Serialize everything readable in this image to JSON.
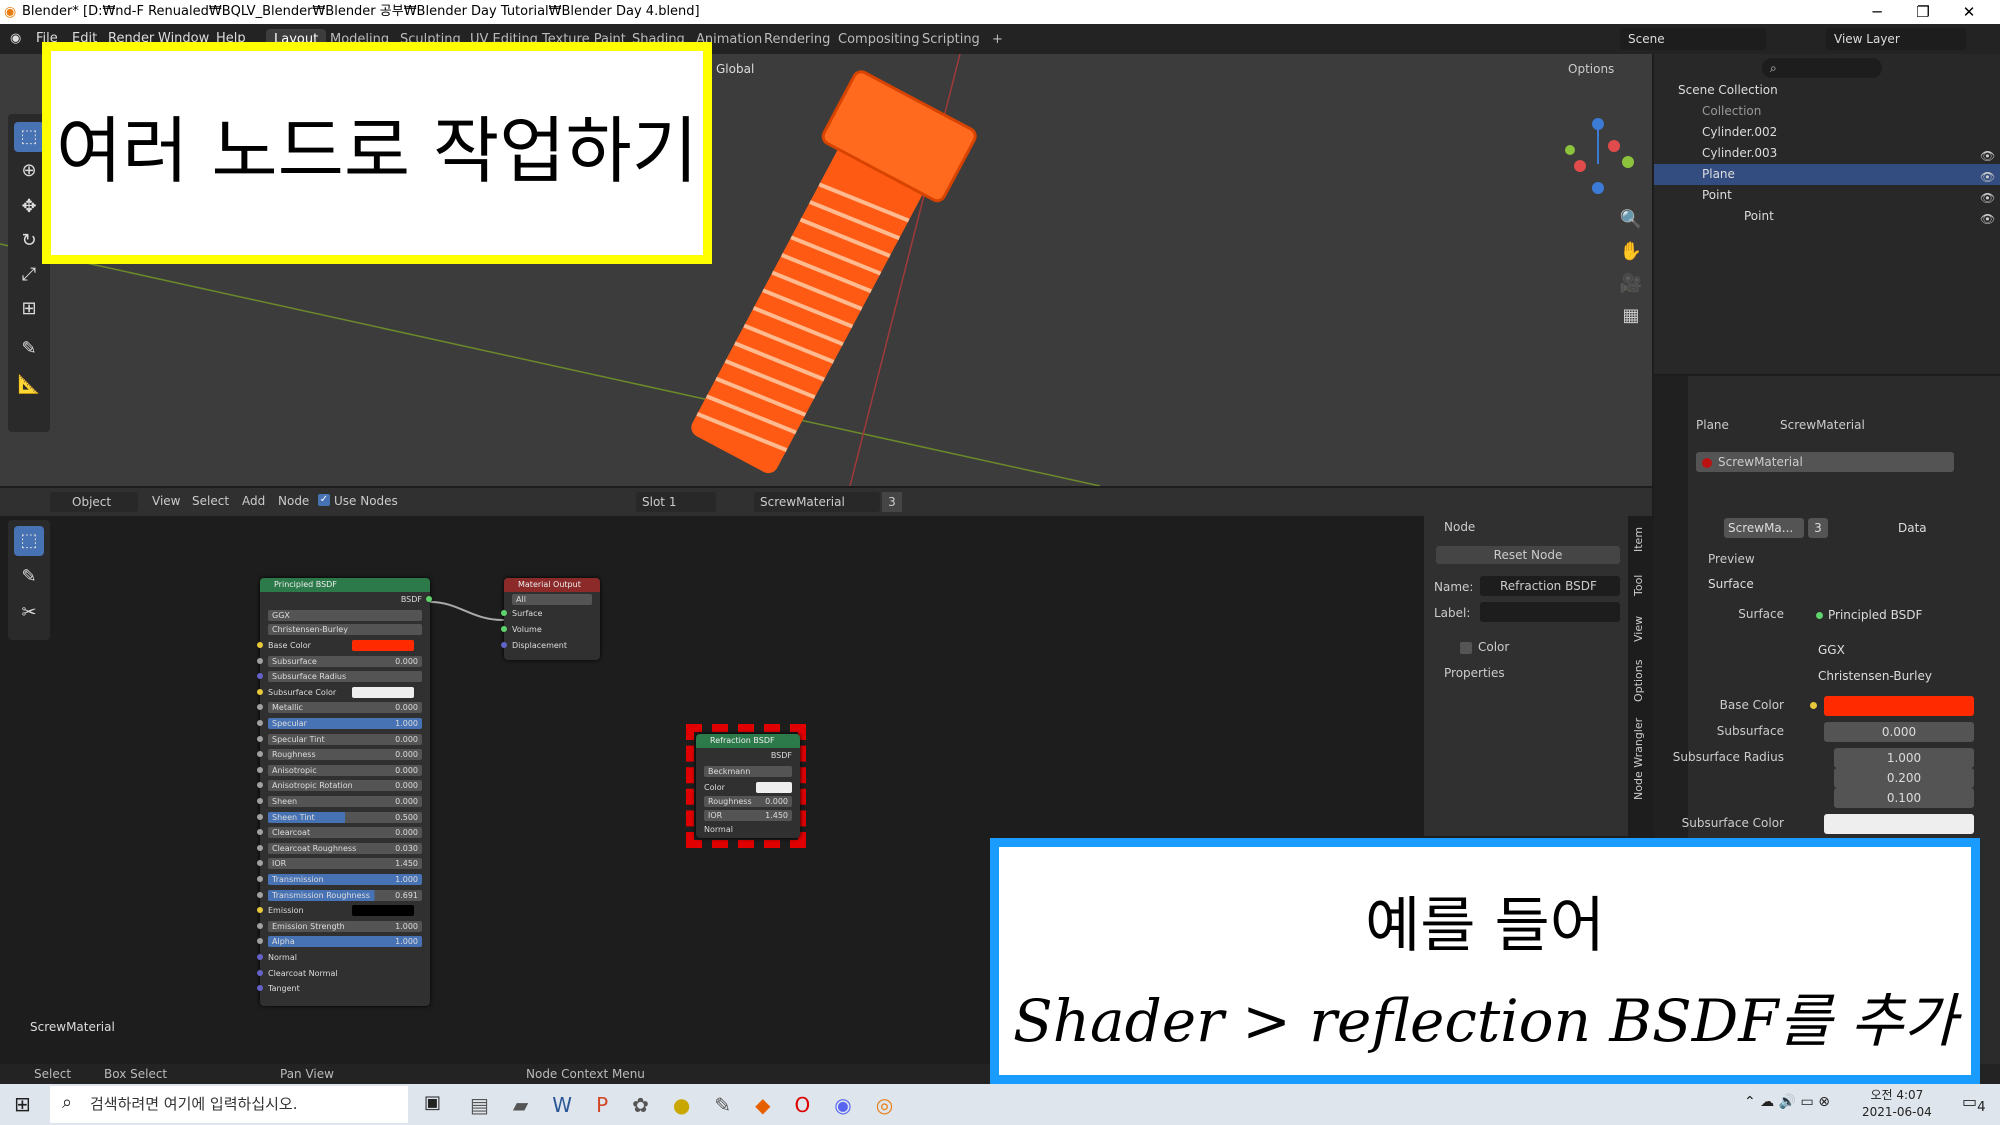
{
  "window": {
    "title": "Blender* [D:₩nd-F Renualed₩BQLV_Blender₩Blender 공부₩Blender Day Tutorial₩Blender Day 4.blend]"
  },
  "menu": {
    "file": "File",
    "edit": "Edit",
    "render": "Render",
    "window": "Window",
    "help": "Help"
  },
  "workspaces": [
    "Layout",
    "Modeling",
    "Sculpting",
    "UV Editing",
    "Texture Paint",
    "Shading",
    "Animation",
    "Rendering",
    "Compositing",
    "Scripting"
  ],
  "scene": {
    "name": "Scene",
    "view_layer": "View Layer"
  },
  "viewport": {
    "orientation": "Global",
    "options": "Options"
  },
  "outliner": {
    "root": "Scene Collection",
    "items": [
      {
        "label": "Collection"
      },
      {
        "label": "Cylinder.002"
      },
      {
        "label": "Cylinder.003"
      },
      {
        "label": "Plane"
      },
      {
        "label": "Point"
      },
      {
        "label": "Point"
      }
    ]
  },
  "properties": {
    "object": "Plane",
    "material": "ScrewMaterial",
    "slot_material": "ScrewMaterial",
    "mat_short": "ScrewMa...",
    "users": "3",
    "data": "Data",
    "preview": "Preview",
    "surface_section": "Surface",
    "surface_label": "Surface",
    "surface_value": "Principled BSDF",
    "distribution": "GGX",
    "subsurface_method": "Christensen-Burley",
    "base_color_label": "Base Color",
    "subsurface_label": "Subsurface",
    "subsurface_value": "0.000",
    "subsurface_radius_label": "Subsurface Radius",
    "radius": [
      "1.000",
      "0.200",
      "0.100"
    ],
    "subsurface_color_label": "Subsurface Color"
  },
  "node_header": {
    "mode": "Object",
    "view": "View",
    "select": "Select",
    "add": "Add",
    "node": "Node",
    "use_nodes": "Use Nodes",
    "slot": "Slot 1",
    "material": "ScrewMaterial",
    "users": "3"
  },
  "node_sidebar": {
    "section": "Node",
    "reset": "Reset Node",
    "name_label": "Name:",
    "name_value": "Refraction BSDF",
    "label_label": "Label:",
    "color": "Color",
    "properties": "Properties"
  },
  "sidebar_tabs": [
    "Item",
    "Tool",
    "View",
    "Options",
    "Node Wrangler"
  ],
  "principled": {
    "title": "Principled BSDF",
    "output": "BSDF",
    "dist": "GGX",
    "sss": "Christensen-Burley",
    "rows": [
      {
        "label": "Base Color",
        "value": ""
      },
      {
        "label": "Subsurface",
        "value": "0.000"
      },
      {
        "label": "Subsurface Radius",
        "value": ""
      },
      {
        "label": "Subsurface Color",
        "value": ""
      },
      {
        "label": "Metallic",
        "value": "0.000"
      },
      {
        "label": "Specular",
        "value": "1.000"
      },
      {
        "label": "Specular Tint",
        "value": "0.000"
      },
      {
        "label": "Roughness",
        "value": "0.000"
      },
      {
        "label": "Anisotropic",
        "value": "0.000"
      },
      {
        "label": "Anisotropic Rotation",
        "value": "0.000"
      },
      {
        "label": "Sheen",
        "value": "0.000"
      },
      {
        "label": "Sheen Tint",
        "value": "0.500"
      },
      {
        "label": "Clearcoat",
        "value": "0.000"
      },
      {
        "label": "Clearcoat Roughness",
        "value": "0.030"
      },
      {
        "label": "IOR",
        "value": "1.450"
      },
      {
        "label": "Transmission",
        "value": "1.000"
      },
      {
        "label": "Transmission Roughness",
        "value": "0.691"
      },
      {
        "label": "Emission",
        "value": ""
      },
      {
        "label": "Emission Strength",
        "value": "1.000"
      },
      {
        "label": "Alpha",
        "value": "1.000"
      },
      {
        "label": "Normal",
        "value": ""
      },
      {
        "label": "Clearcoat Normal",
        "value": ""
      },
      {
        "label": "Tangent",
        "value": ""
      }
    ]
  },
  "material_output": {
    "title": "Material Output",
    "target": "All",
    "inputs": [
      "Surface",
      "Volume",
      "Displacement"
    ]
  },
  "refraction": {
    "title": "Refraction BSDF",
    "output": "BSDF",
    "dist": "Beckmann",
    "color": "Color",
    "roughness": "Roughness",
    "roughness_value": "0.000",
    "ior": "IOR",
    "ior_value": "1.450",
    "normal": "Normal"
  },
  "node_tree_name": "ScrewMaterial",
  "status": {
    "select": "Select",
    "box_select": "Box Select",
    "pan": "Pan View",
    "context": "Node Context Menu"
  },
  "taskbar": {
    "search_placeholder": "검색하려면 여기에 입력하십시오.",
    "time": "오전 4:07",
    "date": "2021-06-04",
    "notif": "4"
  },
  "overlay": {
    "title": "여러 노드로 작업하기",
    "line1": "예를 들어",
    "line2": "Shader > reflection BSDF를 추가"
  },
  "colors": {
    "accent": "#4772b3",
    "base_color": "#ff2a00",
    "highlight_yellow": "#ffff00",
    "highlight_blue": "#1a9cff"
  }
}
